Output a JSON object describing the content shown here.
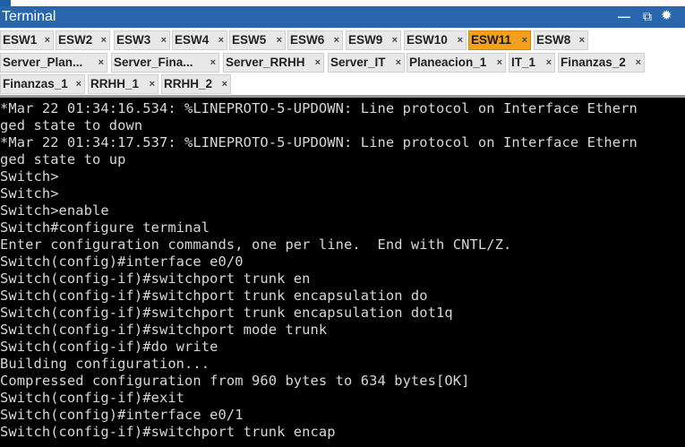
{
  "window": {
    "title": "Terminal",
    "controls": {
      "minimize": "—",
      "restore": "⧉",
      "settings": "✹"
    }
  },
  "tabs": {
    "close_glyph": "×",
    "row1": [
      {
        "label": "ESW1"
      },
      {
        "label": "ESW2"
      },
      {
        "label": "ESW3"
      },
      {
        "label": "ESW4"
      },
      {
        "label": "ESW5"
      },
      {
        "label": "ESW6"
      },
      {
        "label": "ESW9"
      },
      {
        "label": "ESW10"
      },
      {
        "label": "ESW11",
        "active": true
      },
      {
        "label": "ESW8"
      }
    ],
    "row2": [
      {
        "label": "Server_Plan..."
      },
      {
        "label": "Server_Fina..."
      },
      {
        "label": "Server_RRHH"
      },
      {
        "label": "Server_IT"
      },
      {
        "label": "Planeacion_1"
      },
      {
        "label": "IT_1"
      },
      {
        "label": "Finanzas_2"
      }
    ],
    "row3": [
      {
        "label": "Finanzas_1"
      },
      {
        "label": "RRHH_1"
      },
      {
        "label": "RRHH_2"
      }
    ]
  },
  "terminal": {
    "lines": [
      "*Mar 22 01:34:16.534: %LINEPROTO-5-UPDOWN: Line protocol on Interface Ethern",
      "ged state to down",
      "*Mar 22 01:34:17.537: %LINEPROTO-5-UPDOWN: Line protocol on Interface Ethern",
      "ged state to up",
      "Switch>",
      "Switch>",
      "Switch>enable",
      "Switch#configure terminal",
      "Enter configuration commands, one per line.  End with CNTL/Z.",
      "Switch(config)#interface e0/0",
      "Switch(config-if)#switchport trunk en",
      "Switch(config-if)#switchport trunk encapsulation do",
      "Switch(config-if)#switchport trunk encapsulation dot1q",
      "Switch(config-if)#switchport mode trunk",
      "Switch(config-if)#do write",
      "Building configuration...",
      "Compressed configuration from 960 bytes to 634 bytes[OK]",
      "Switch(config-if)#exit",
      "Switch(config)#interface e0/1",
      "Switch(config-if)#switchport trunk encap"
    ]
  },
  "colors": {
    "titlebar": "#2a66ad",
    "tab_bg": "#e8e8e8",
    "tab_active": "#f2a11f",
    "terminal_bg": "#000000",
    "terminal_fg": "#d7d7d7"
  }
}
